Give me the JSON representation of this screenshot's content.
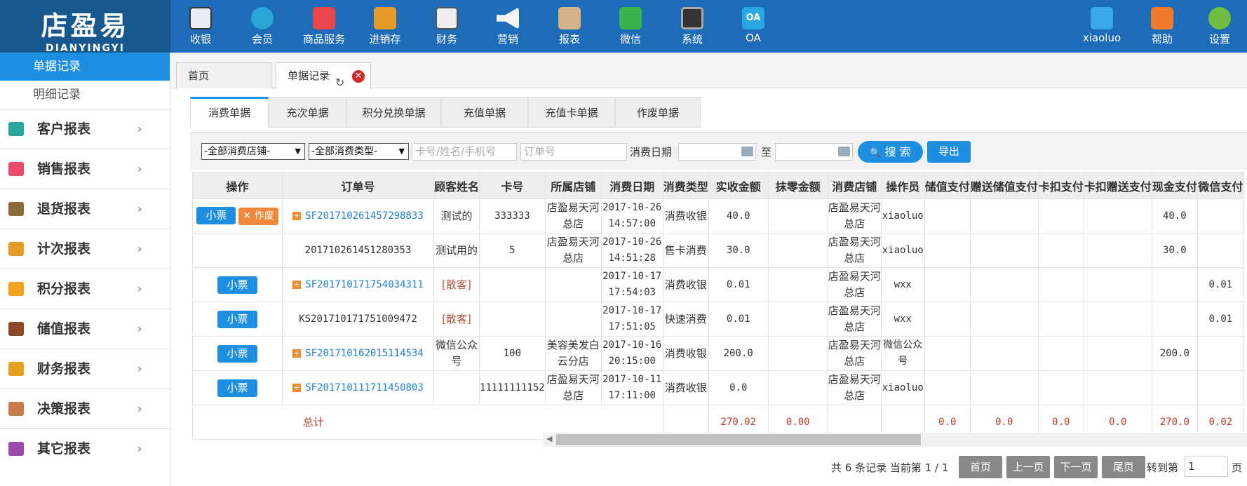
{
  "logo": {
    "cn": "店盈易",
    "en": "DIANYINGYI"
  },
  "nav": [
    {
      "label": "收银",
      "icon": "cash-register-icon"
    },
    {
      "label": "会员",
      "icon": "member-icon"
    },
    {
      "label": "商品服务",
      "icon": "goods-icon"
    },
    {
      "label": "进销存",
      "icon": "inventory-icon"
    },
    {
      "label": "财务",
      "icon": "finance-icon"
    },
    {
      "label": "营销",
      "icon": "megaphone-icon"
    },
    {
      "label": "报表",
      "icon": "report-icon"
    },
    {
      "label": "微信",
      "icon": "wechat-icon"
    },
    {
      "label": "系统",
      "icon": "monitor-icon"
    },
    {
      "label": "OA",
      "icon": "oa-icon",
      "icon_text": "OA"
    }
  ],
  "user": {
    "name": "xiaoluo",
    "help": "帮助",
    "settings": "设置"
  },
  "sidebar": {
    "sub_items": [
      "单据记录",
      "明细记录"
    ],
    "groups": [
      {
        "label": "客户报表",
        "color": "#2aa6a0"
      },
      {
        "label": "销售报表",
        "color": "#e84a6a"
      },
      {
        "label": "退货报表",
        "color": "#8a6a3a"
      },
      {
        "label": "计次报表",
        "color": "#e59a2a"
      },
      {
        "label": "积分报表",
        "color": "#f2a020"
      },
      {
        "label": "储值报表",
        "color": "#8a4a2a"
      },
      {
        "label": "财务报表",
        "color": "#e8a020"
      },
      {
        "label": "决策报表",
        "color": "#c87a4a"
      },
      {
        "label": "其它报表",
        "color": "#9a4aa8"
      }
    ]
  },
  "tabs": {
    "home": "首页",
    "current": "单据记录",
    "refresh_icon": "↻",
    "close_icon": "✕"
  },
  "subtabs": [
    "消费单据",
    "充次单据",
    "积分兑换单据",
    "充值单据",
    "充值卡单据",
    "作废单据"
  ],
  "filter": {
    "store": "-全部消费店铺-",
    "type": "-全部消费类型-",
    "card_placeholder": "卡号/姓名/手机号",
    "order_placeholder": "订单号",
    "date_label": "消费日期",
    "to": "至",
    "search": "搜 索",
    "search_icon": "🔍",
    "export": "导出"
  },
  "table": {
    "headers": [
      "操作",
      "订单号",
      "顾客姓名",
      "卡号",
      "所属店铺",
      "消费日期",
      "消费类型",
      "实收金额",
      "抹零金额",
      "消费店铺",
      "操作员",
      "储值支付",
      "赠送储值支付",
      "卡扣支付",
      "卡扣赠送支付",
      "现金支付",
      "微信支付"
    ],
    "receipt_label": "小票",
    "void_label": "作废",
    "rows": [
      {
        "order": "SF201710261457298833",
        "name": "测试的",
        "card": "333333",
        "store": "店盈易天河总店",
        "date": "2017-10-26",
        "time": "14:57:00",
        "type": "消费收银",
        "amount": "40.0",
        "round": "",
        "cstore": "店盈易天河总店",
        "op": "xiaoluo",
        "p1": "",
        "p2": "",
        "p3": "",
        "p4": "",
        "cash": "40.0",
        "wx": ""
      },
      {
        "order": "201710261451280353",
        "name": "测试用的",
        "card": "5",
        "store": "店盈易天河总店",
        "date": "2017-10-26",
        "time": "14:51:28",
        "type": "售卡消费",
        "amount": "30.0",
        "round": "",
        "cstore": "店盈易天河总店",
        "op": "xiaoluo",
        "p1": "",
        "p2": "",
        "p3": "",
        "p4": "",
        "cash": "30.0",
        "wx": ""
      },
      {
        "order": "SF201710171754034311",
        "name": "[散客]",
        "card": "",
        "store": "",
        "date": "2017-10-17",
        "time": "17:54:03",
        "type": "消费收银",
        "amount": "0.01",
        "round": "",
        "cstore": "店盈易天河总店",
        "op": "wxx",
        "p1": "",
        "p2": "",
        "p3": "",
        "p4": "",
        "cash": "",
        "wx": "0.01"
      },
      {
        "order": "KS201710171751009472",
        "name": "[散客]",
        "card": "",
        "store": "",
        "date": "2017-10-17",
        "time": "17:51:05",
        "type": "快速消费",
        "amount": "0.01",
        "round": "",
        "cstore": "店盈易天河总店",
        "op": "wxx",
        "p1": "",
        "p2": "",
        "p3": "",
        "p4": "",
        "cash": "",
        "wx": "0.01"
      },
      {
        "order": "SF201710162015114534",
        "name": "微信公众号",
        "card": "100",
        "store": "美容美发白云分店",
        "date": "2017-10-16",
        "time": "20:15:00",
        "type": "消费收银",
        "amount": "200.0",
        "round": "",
        "cstore": "店盈易天河总店",
        "op": "微信公众号",
        "p1": "",
        "p2": "",
        "p3": "",
        "p4": "",
        "cash": "200.0",
        "wx": ""
      },
      {
        "order": "SF201710111711450803",
        "name": "",
        "card": "11111111152",
        "store": "店盈易天河总店",
        "date": "2017-10-11",
        "time": "17:11:00",
        "type": "消费收银",
        "amount": "0.0",
        "round": "",
        "cstore": "店盈易天河总店",
        "op": "xiaoluo",
        "p1": "",
        "p2": "",
        "p3": "",
        "p4": "",
        "cash": "",
        "wx": ""
      }
    ],
    "total": {
      "label": "总计",
      "amount": "270.02",
      "round": "0.00",
      "p1": "0.0",
      "p2": "0.0",
      "p3": "0.0",
      "p4": "0.0",
      "cash": "270.0",
      "wx": "0.02"
    }
  },
  "pager": {
    "info": "共 6 条记录 当前第 1 / 1",
    "first": "首页",
    "prev": "上一页",
    "next": "下一页",
    "last": "尾页",
    "jump": "转到第",
    "page": "1",
    "unit": "页"
  }
}
